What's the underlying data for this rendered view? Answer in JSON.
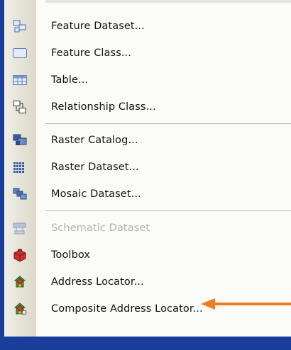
{
  "menu": {
    "items": [
      {
        "label": "Feature Dataset...",
        "icon": "feature-dataset-icon",
        "enabled": true
      },
      {
        "label": "Feature Class...",
        "icon": "feature-class-icon",
        "enabled": true
      },
      {
        "label": "Table...",
        "icon": "table-icon",
        "enabled": true
      },
      {
        "label": "Relationship Class...",
        "icon": "relationship-class-icon",
        "enabled": true
      },
      {
        "label": "Raster Catalog...",
        "icon": "raster-catalog-icon",
        "enabled": true
      },
      {
        "label": "Raster Dataset...",
        "icon": "raster-dataset-icon",
        "enabled": true
      },
      {
        "label": "Mosaic Dataset...",
        "icon": "mosaic-dataset-icon",
        "enabled": true
      },
      {
        "label": "Schematic Dataset",
        "icon": "schematic-dataset-icon",
        "enabled": false
      },
      {
        "label": "Toolbox",
        "icon": "toolbox-icon",
        "enabled": true
      },
      {
        "label": "Address Locator...",
        "icon": "address-locator-icon",
        "enabled": true
      },
      {
        "label": "Composite Address Locator...",
        "icon": "composite-address-locator-icon",
        "enabled": true
      }
    ]
  },
  "annotation": {
    "arrow_target": "Address Locator...",
    "arrow_color": "#f07c1f"
  },
  "colors": {
    "background": "#1a3f9a",
    "menu_bg": "#fbfbf9",
    "disabled_text": "#b2b1ac"
  }
}
